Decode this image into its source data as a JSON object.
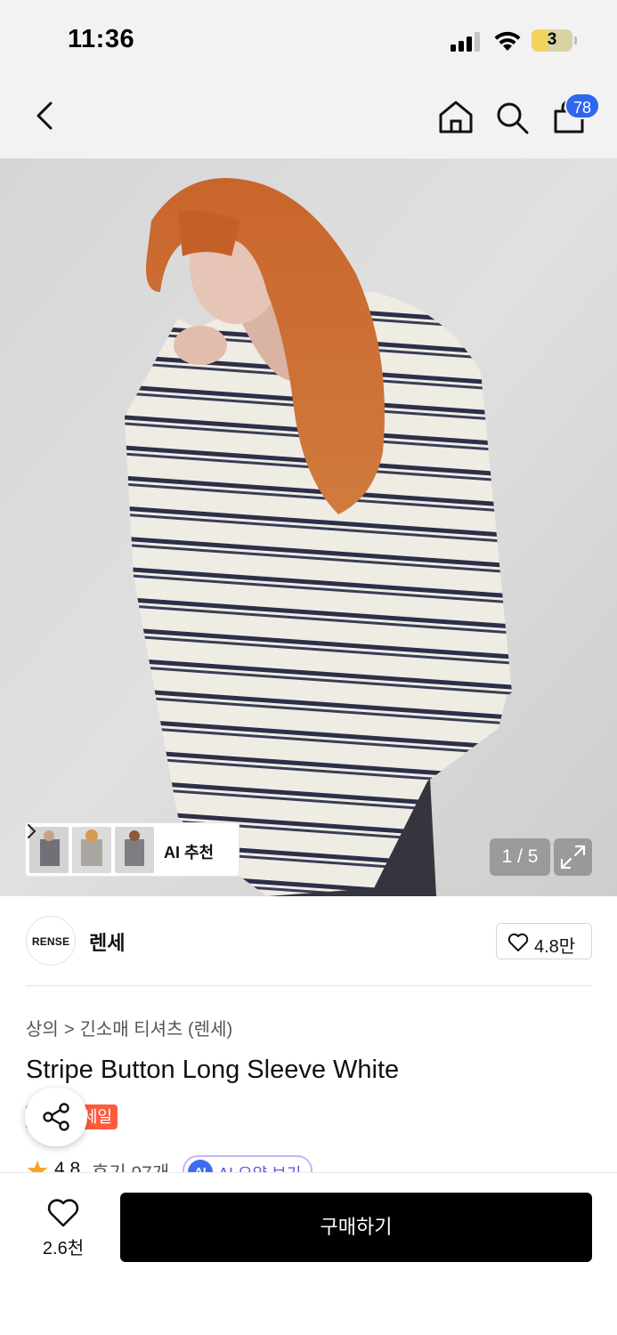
{
  "status_bar": {
    "time": "11:36",
    "battery_level": "3",
    "signal_bars_active": 3,
    "signal_bars_total": 4
  },
  "nav": {
    "back_icon": "chevron-left-icon",
    "home_icon": "home-icon",
    "search_icon": "search-icon",
    "cart_icon": "shopping-bag-icon",
    "cart_badge": "78",
    "badge_color": "#2f66f0"
  },
  "gallery": {
    "ai_recommend_label": "AI 추천",
    "page_indicator": "1 / 5",
    "expand_icon": "expand-icon"
  },
  "brand": {
    "logo_text": "RENSE",
    "name": "렌세",
    "likes": "4.8만"
  },
  "product": {
    "breadcrumb": [
      "상의",
      "긴소매 티셔츠 (렌세)"
    ],
    "title": "Stripe Button Long Sleeve White",
    "badge": "세일",
    "badge_color": "#ff5a3c",
    "rating": "4.8",
    "review_count": "후기 97개",
    "ai_badge": "AI",
    "ai_summary_label": "AI 요약 보기"
  },
  "bottom_bar": {
    "wishlist_count": "2.6천",
    "buy_label": "구매하기"
  }
}
